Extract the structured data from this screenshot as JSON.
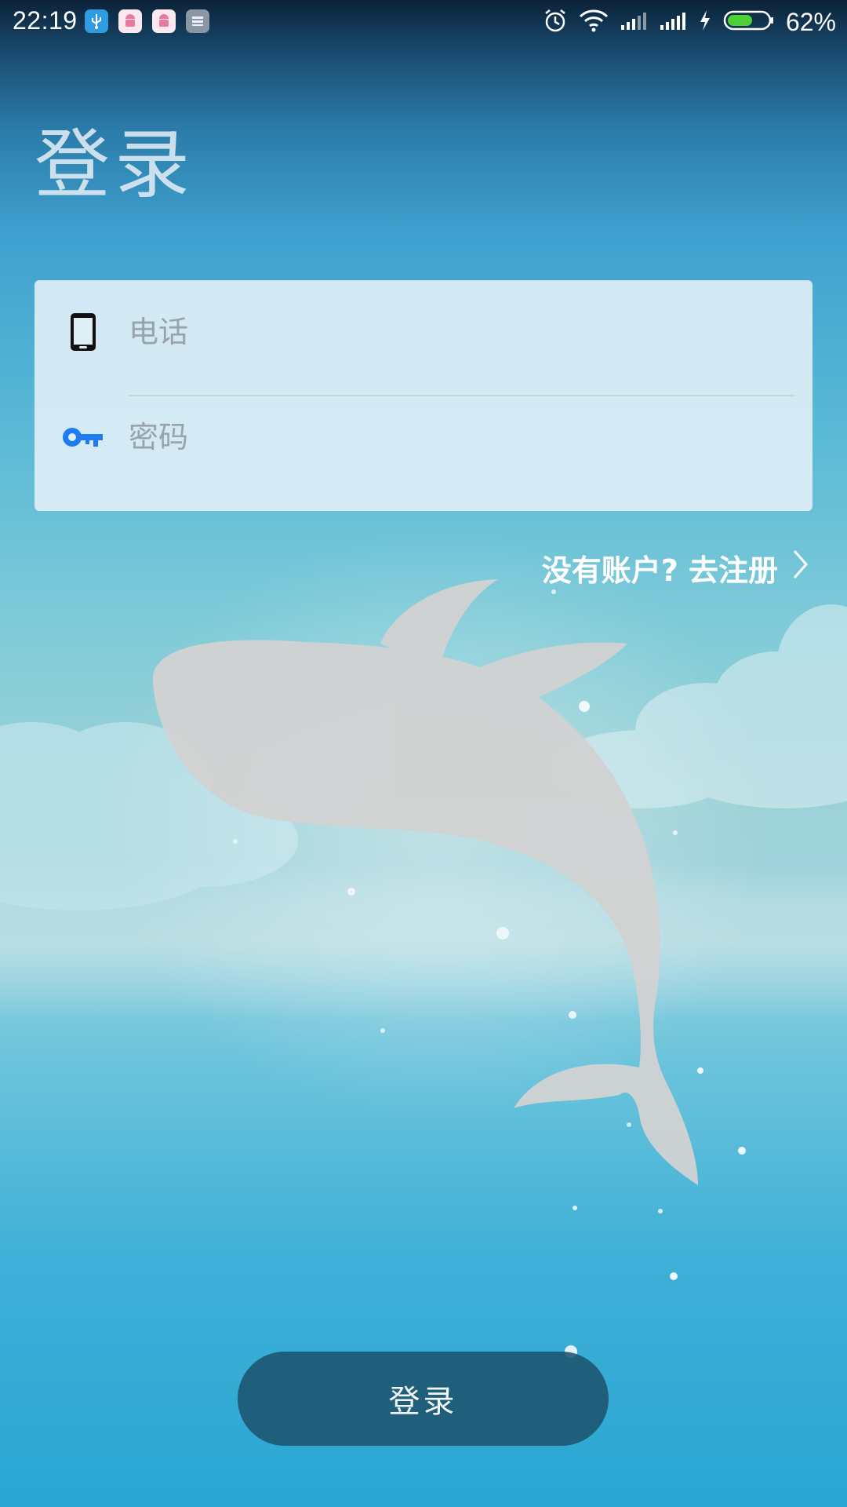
{
  "status_bar": {
    "time": "22:19",
    "battery_percent": "62%",
    "battery_level": 0.62,
    "battery_color": "#4cd137",
    "notification_icons": [
      "usb-icon",
      "android-icon",
      "android-icon",
      "storage-icon"
    ],
    "right_icons": [
      "alarm-icon",
      "wifi-icon",
      "signal-icon",
      "signal-icon",
      "charging-icon",
      "battery-icon"
    ]
  },
  "page": {
    "title": "登录"
  },
  "form": {
    "phone": {
      "placeholder": "电话",
      "value": "",
      "icon": "phone-icon"
    },
    "password": {
      "placeholder": "密码",
      "value": "",
      "icon": "key-icon",
      "icon_color": "#1e7cf0"
    }
  },
  "register_link": {
    "label": "没有账户? 去注册",
    "icon": "chevron-right-icon"
  },
  "login_button": {
    "label": "登录"
  }
}
